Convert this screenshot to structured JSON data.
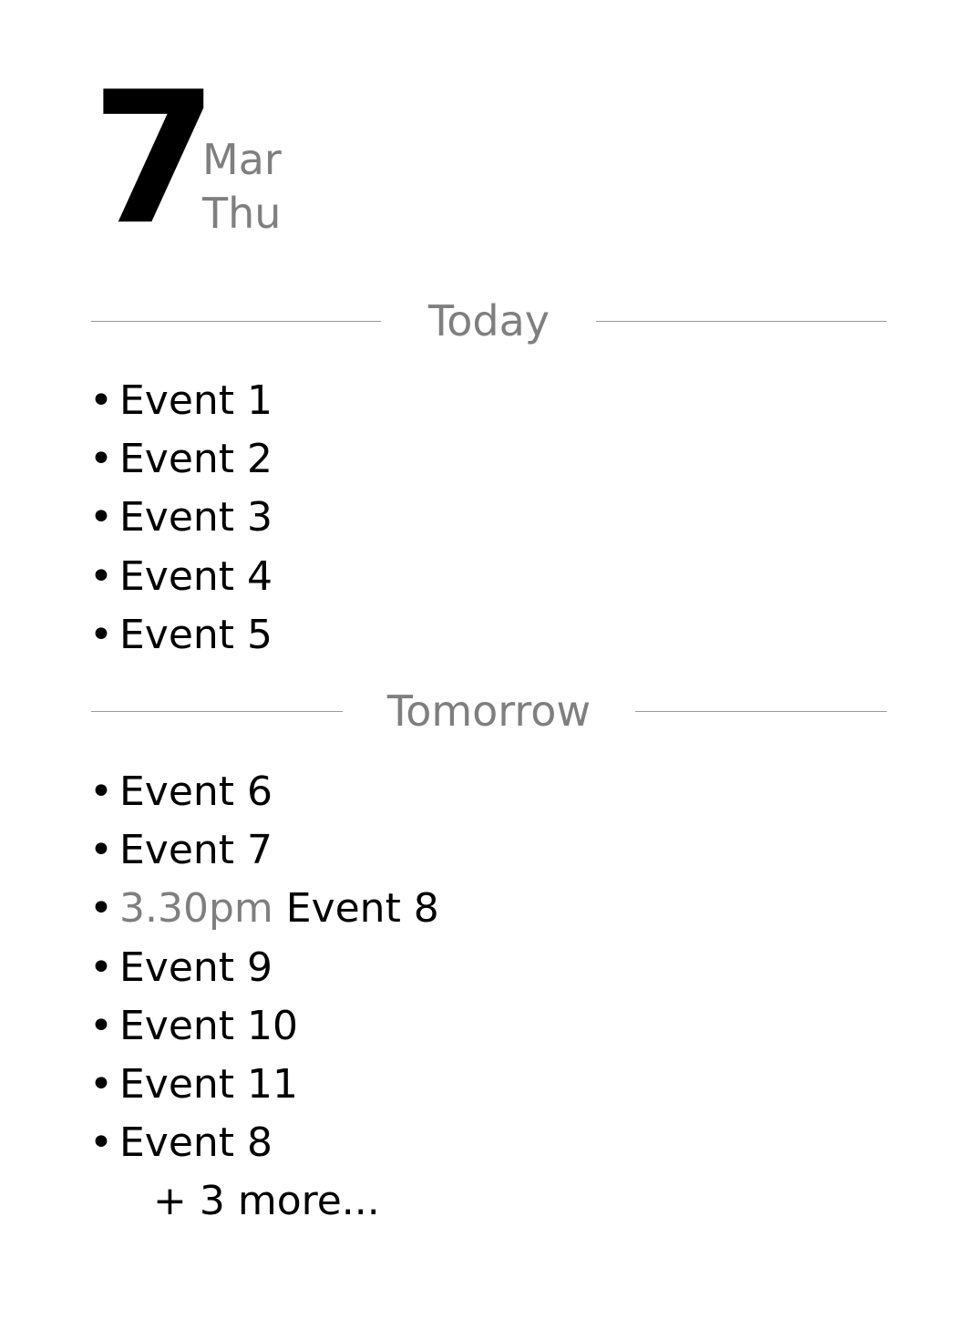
{
  "date": {
    "day": "7",
    "month": "Mar",
    "weekday": "Thu"
  },
  "sections": {
    "today": {
      "label": "Today",
      "events": [
        {
          "bullet": "•",
          "time": "",
          "title": "Event 1"
        },
        {
          "bullet": "•",
          "time": "",
          "title": "Event 2"
        },
        {
          "bullet": "•",
          "time": "",
          "title": "Event 3"
        },
        {
          "bullet": "•",
          "time": "",
          "title": "Event 4"
        },
        {
          "bullet": "•",
          "time": "",
          "title": "Event 5"
        }
      ]
    },
    "tomorrow": {
      "label": "Tomorrow",
      "events": [
        {
          "bullet": "•",
          "time": "",
          "title": "Event 6"
        },
        {
          "bullet": "•",
          "time": "",
          "title": "Event 7"
        },
        {
          "bullet": "•",
          "time": "3.30pm",
          "title": "Event 8"
        },
        {
          "bullet": "•",
          "time": "",
          "title": "Event 9"
        },
        {
          "bullet": "•",
          "time": "",
          "title": "Event 10"
        },
        {
          "bullet": "•",
          "time": "",
          "title": "Event 11"
        },
        {
          "bullet": "•",
          "time": "",
          "title": "Event 8"
        }
      ],
      "more_label": "+ 3 more..."
    }
  },
  "colors": {
    "primary_text": "#000000",
    "secondary_text": "#7f7f7f",
    "divider": "#9a9a9a",
    "background": "#ffffff"
  }
}
